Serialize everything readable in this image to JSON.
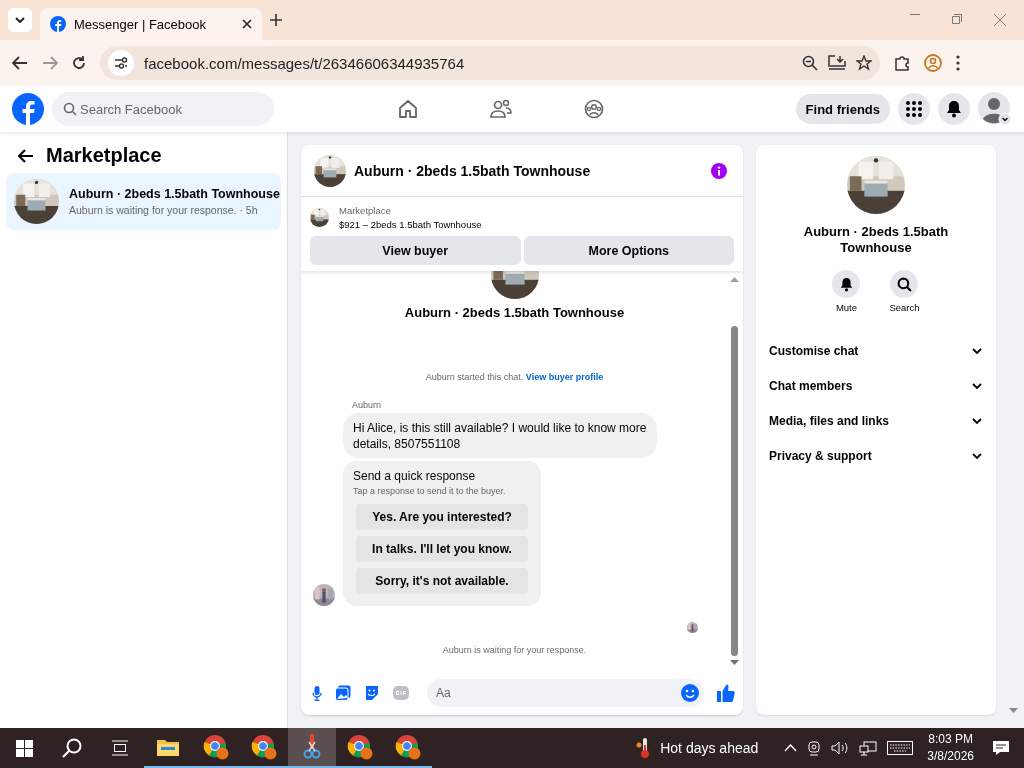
{
  "browser": {
    "tab_title": "Messenger | Facebook",
    "url": "facebook.com/messages/t/26346606344935764"
  },
  "header": {
    "search": {
      "placeholder": "Search Facebook"
    },
    "find_friends": "Find friends"
  },
  "sidebar": {
    "title": "Marketplace",
    "threads": [
      {
        "title": "Auburn · 2beds 1.5bath Townhouse",
        "preview": "Auburn is waiting for your response. · 5h",
        "selected": true
      }
    ]
  },
  "chat": {
    "title": "Auburn · 2beds 1.5bath Townhouse",
    "listing": {
      "label": "Marketplace",
      "summary": "$921 – 2beds 1.5bath Townhouse"
    },
    "actions": [
      "View buyer",
      "More Options"
    ],
    "profile_name": "Auburn · 2beds 1.5bath Townhouse",
    "started": "Auburn started this chat.",
    "started_link": "View buyer profile",
    "sender": "Auburn",
    "message": "Hi Alice, is this still available? I would like to know more details, 8507551108",
    "quick": {
      "title": "Send a quick response",
      "hint": "Tap a response to send it to the buyer.",
      "responses": [
        "Yes. Are you interested?",
        "In talks. I'll let you know.",
        "Sorry, it's not available."
      ]
    },
    "status": "Auburn is waiting for your response.",
    "composer": {
      "placeholder": "Aa"
    }
  },
  "details": {
    "name": "Auburn · 2beds 1.5bath Townhouse",
    "actions": [
      "Mute",
      "Search"
    ],
    "sections": [
      {
        "label": "Customise chat",
        "expanded": false
      },
      {
        "label": "Chat members",
        "expanded": false
      },
      {
        "label": "Media, files and links",
        "expanded": false
      },
      {
        "label": "Privacy & support",
        "expanded": false
      }
    ]
  },
  "taskbar": {
    "apps": [
      {
        "kind": "folder",
        "selected": false
      },
      {
        "kind": "browser",
        "selected": false
      },
      {
        "kind": "browser",
        "selected": false
      },
      {
        "kind": "tool",
        "selected": true
      },
      {
        "kind": "browser",
        "selected": false
      },
      {
        "kind": "browser",
        "selected": false
      }
    ],
    "weather": "Hot days ahead",
    "time": "8:03 PM",
    "date": "3/8/2026"
  }
}
